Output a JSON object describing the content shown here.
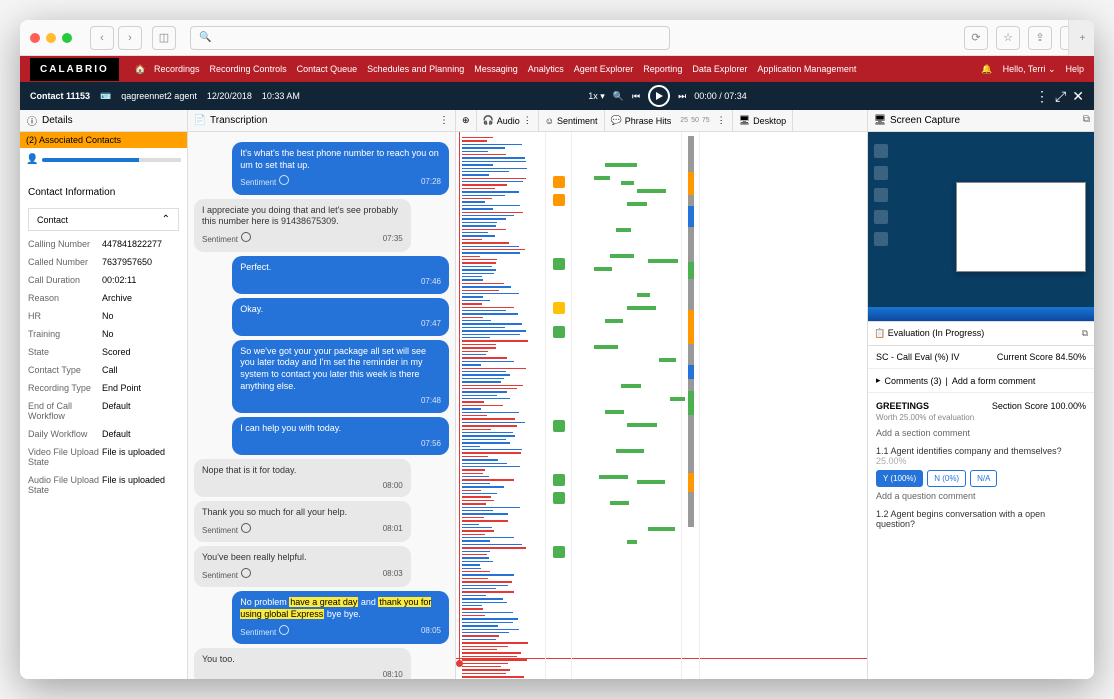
{
  "browser": {
    "traffic_colors": [
      "#ff5f56",
      "#ffbd2e",
      "#27c93f"
    ]
  },
  "nav": {
    "logo": "CALABRIO",
    "items": [
      "Recordings",
      "Recording Controls",
      "Contact Queue",
      "Schedules and Planning",
      "Messaging",
      "Analytics",
      "Agent Explorer",
      "Reporting",
      "Data Explorer",
      "Application Management"
    ],
    "user": "Hello, Terri",
    "help": "Help"
  },
  "subbar": {
    "contact": "Contact 11153",
    "agent": "qagreennet2 agent",
    "date": "12/20/2018",
    "time": "10:33 AM",
    "speed": "1x",
    "position": "00:00 / 07:34"
  },
  "details": {
    "title": "Details",
    "assoc_label": "(2) Associated Contacts",
    "section_label": "Contact Information",
    "collapse_label": "Contact",
    "rows": [
      {
        "k": "Calling Number",
        "v": "447841822277"
      },
      {
        "k": "Called Number",
        "v": "7637957650"
      },
      {
        "k": "Call Duration",
        "v": "00:02:11"
      },
      {
        "k": "Reason",
        "v": "Archive"
      },
      {
        "k": "HR",
        "v": "No"
      },
      {
        "k": "Training",
        "v": "No"
      },
      {
        "k": "State",
        "v": "Scored"
      },
      {
        "k": "Contact Type",
        "v": "Call"
      },
      {
        "k": "Recording Type",
        "v": "End Point"
      },
      {
        "k": "End of Call Workflow",
        "v": "Default"
      },
      {
        "k": "Daily Workflow",
        "v": "Default"
      },
      {
        "k": "Video File Upload State",
        "v": "File is uploaded"
      },
      {
        "k": "Audio File Upload State",
        "v": "File is uploaded"
      }
    ]
  },
  "transcript": {
    "title": "Transcription",
    "sentiment_label": "Sentiment",
    "messages": [
      {
        "who": "agent",
        "text": "It's what's the best phone number to reach you on um to set that up.",
        "ts": "07:28",
        "sent": true
      },
      {
        "who": "cust",
        "text": "I appreciate you doing that and let's see probably this number here is 91438675309.",
        "ts": "07:35",
        "sent": true
      },
      {
        "who": "agent",
        "text": "Perfect.",
        "ts": "07:46"
      },
      {
        "who": "agent",
        "text": "Okay.",
        "ts": "07:47"
      },
      {
        "who": "agent",
        "text": "So we've got your your package all set will see you later today and I'm set the reminder in my system to contact you later this week is there anything else.",
        "ts": "07:48"
      },
      {
        "who": "agent",
        "text": "I can help you with today.",
        "ts": "07:56"
      },
      {
        "who": "cust",
        "text": "Nope that is it for today.",
        "ts": "08:00"
      },
      {
        "who": "cust",
        "text": "Thank you so much for all your help.",
        "ts": "08:01",
        "sent": true
      },
      {
        "who": "cust",
        "text": "You've been really helpful.",
        "ts": "08:03",
        "sent": true
      },
      {
        "who": "agent",
        "text_parts": [
          "No problem ",
          {
            "hl": "have a great day"
          },
          " and ",
          {
            "hl": "thank you for using global Express"
          },
          " bye bye."
        ],
        "ts": "08:05",
        "sent": true
      },
      {
        "who": "cust",
        "text": "You too.",
        "ts": "08:10"
      }
    ],
    "footer_ts": "08:10"
  },
  "viz": {
    "headers": {
      "audio": "Audio",
      "sentiment": "Sentiment",
      "phrase": "Phrase Hits",
      "desktop": "Desktop"
    },
    "phrase_ticks": [
      "25",
      "50",
      "75"
    ]
  },
  "screencap": {
    "title": "Screen Capture"
  },
  "evaluation": {
    "title": "Evaluation (In Progress)",
    "form_name": "SC - Call Eval (%) IV",
    "score_label": "Current Score",
    "score_value": "84.50%",
    "comments_label": "Comments (3)",
    "add_form_comment": "Add a form comment",
    "section": {
      "name": "GREETINGS",
      "score_label": "Section Score",
      "score_value": "100.00%",
      "worth": "Worth 25.00% of evaluation",
      "add_section_comment": "Add a section comment",
      "questions": [
        {
          "num": "1.1",
          "text": "Agent identifies company and themselves?",
          "pct": "25.00%",
          "answers": [
            {
              "l": "Y (100%)",
              "sel": true
            },
            {
              "l": "N (0%)"
            },
            {
              "l": "N/A"
            }
          ],
          "add_comment": "Add a question comment"
        },
        {
          "num": "1.2",
          "text": "Agent begins conversation with a open question?"
        }
      ]
    }
  }
}
